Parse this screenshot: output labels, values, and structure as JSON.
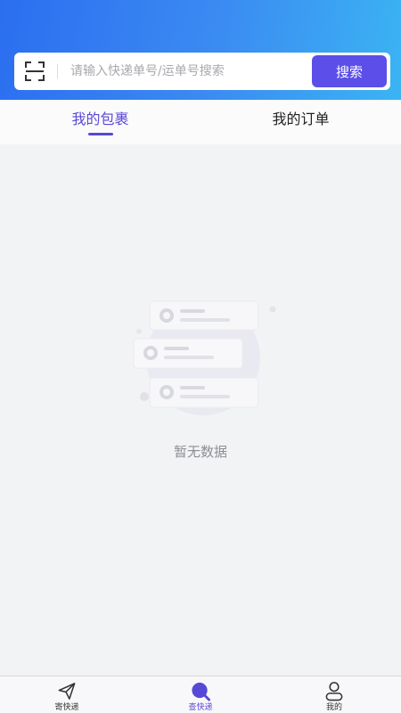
{
  "search": {
    "placeholder": "请输入快递单号/运单号搜索",
    "button_label": "搜索"
  },
  "tabs": [
    {
      "label": "我的包裹",
      "active": true
    },
    {
      "label": "我的订单",
      "active": false
    }
  ],
  "empty_state": {
    "text": "暂无数据",
    "illustration": "empty-list-illustration"
  },
  "tabbar": [
    {
      "label": "寄快递",
      "icon": "send-icon",
      "active": false
    },
    {
      "label": "查快递",
      "icon": "search-icon",
      "active": true
    },
    {
      "label": "我的",
      "icon": "user-icon",
      "active": false
    }
  ],
  "colors": {
    "header_gradient_start": "#2b6ef0",
    "header_gradient_end": "#3bb4f3",
    "accent": "#5848d6",
    "search_button": "#5b4ee9",
    "background": "#f2f3f5"
  }
}
